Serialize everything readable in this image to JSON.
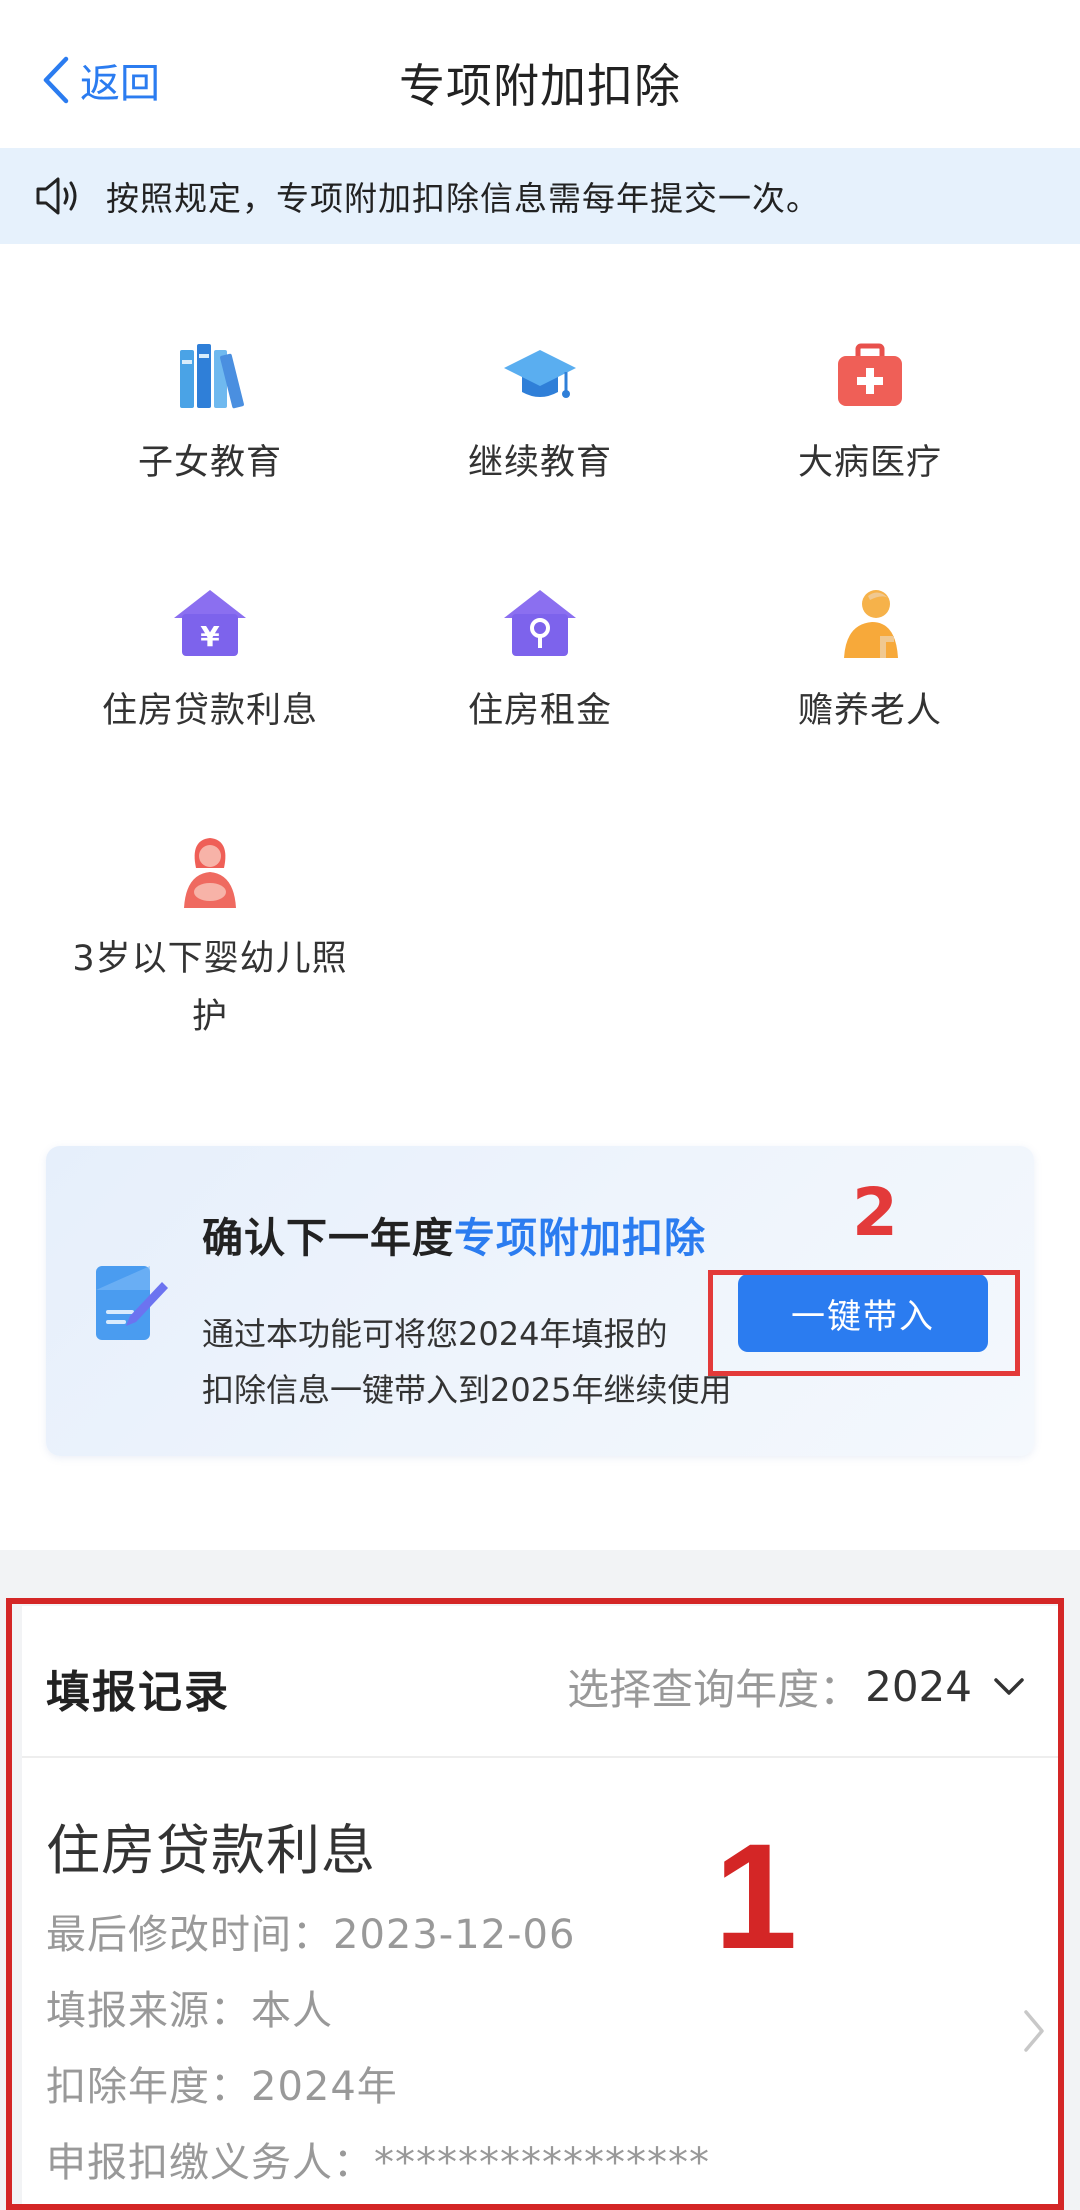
{
  "header": {
    "back_label": "返回",
    "title": "专项附加扣除"
  },
  "notice": {
    "text": "按照规定，专项附加扣除信息需每年提交一次。"
  },
  "categories": [
    {
      "label": "子女教育",
      "icon": "books-icon"
    },
    {
      "label": "继续教育",
      "icon": "graduation-cap-icon"
    },
    {
      "label": "大病医疗",
      "icon": "medical-kit-icon"
    },
    {
      "label": "住房贷款利息",
      "icon": "house-yen-icon"
    },
    {
      "label": "住房租金",
      "icon": "house-key-icon"
    },
    {
      "label": "赡养老人",
      "icon": "elderly-person-icon"
    },
    {
      "label_line1": "3岁以下婴幼儿照",
      "label_line2": "护",
      "icon": "mother-baby-icon"
    }
  ],
  "confirm_card": {
    "title_prefix": "确认下一年度",
    "title_highlight": "专项附加扣除",
    "desc_line1": "通过本功能可将您2024年填报的",
    "desc_line2": "扣除信息一键带入到2025年继续使用",
    "button_label": "一键带入"
  },
  "annotations": {
    "marker_1": "1",
    "marker_2": "2"
  },
  "records": {
    "heading": "填报记录",
    "year_select_label": "选择查询年度：",
    "year_value": "2024",
    "items": [
      {
        "name": "住房贷款利息",
        "modified": "最后修改时间：2023-12-06",
        "source": "填报来源：本人",
        "year": "扣除年度：2024年",
        "withholder": "申报扣缴义务人：****************"
      }
    ]
  },
  "colors": {
    "accent": "#2b7cf0",
    "annotation_red": "#e33a3a",
    "notice_bg": "#e6f1fc"
  }
}
